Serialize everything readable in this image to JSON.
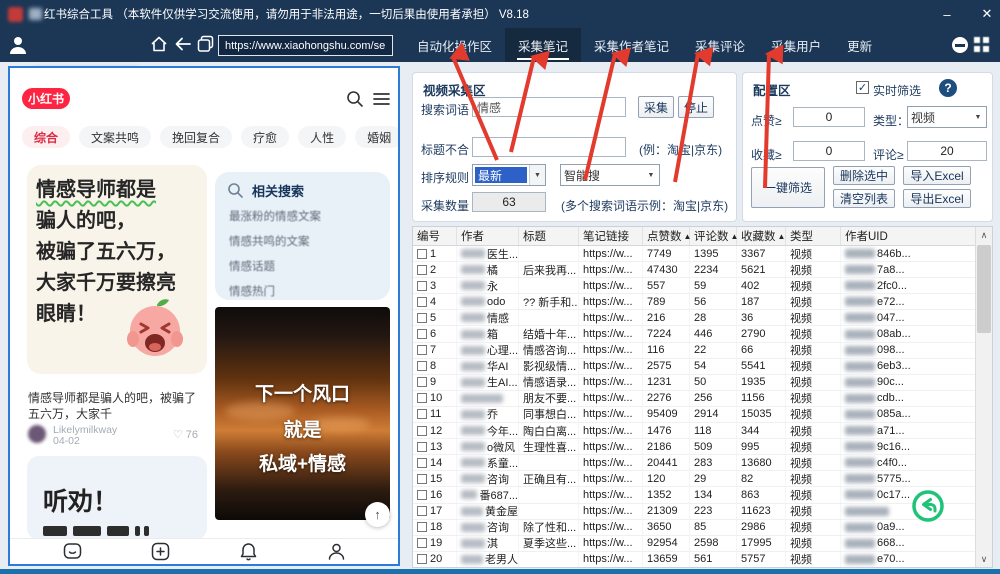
{
  "titlebar": {
    "app_title": "红书综合工具  （本软件仅供学习交流使用，请勿用于非法用途，一切后果由使用者承担）  V8.18",
    "minimize": "–",
    "close": "✕"
  },
  "navbar": {
    "url": "https://www.xiaohongshu.com/se",
    "tabs": [
      {
        "label": "自动化操作区",
        "active": false
      },
      {
        "label": "采集笔记",
        "active": true
      },
      {
        "label": "采集作者笔记",
        "active": false
      },
      {
        "label": "采集评论",
        "active": false
      },
      {
        "label": "采集用户",
        "active": false
      },
      {
        "label": "更新",
        "active": false
      }
    ]
  },
  "browser": {
    "logo": "小红书",
    "categories": [
      {
        "label": "综合",
        "active": true
      },
      {
        "label": "文案共鸣",
        "active": false
      },
      {
        "label": "挽回复合",
        "active": false
      },
      {
        "label": "疗愈",
        "active": false
      },
      {
        "label": "人性",
        "active": false
      },
      {
        "label": "婚姻",
        "active": false
      }
    ],
    "chevron": "›",
    "post1": {
      "lines": [
        "情感导师都是",
        "骗人的吧，",
        "被骗了五六万，",
        "大家千万要擦亮",
        "眼睛！"
      ],
      "caption": "情感导师都是骗人的吧，被骗了五六万，大家千",
      "author": "Likelymilkway",
      "date": "04-02",
      "likes": "76",
      "like_icon": "♡"
    },
    "related": {
      "title": "相关搜索",
      "items": [
        "最涨粉的情感文案",
        "情感共鸣的文案",
        "情感话题",
        "情感热门"
      ]
    },
    "post2": {
      "lines": [
        "下一个风口",
        "就是",
        "私域+情感"
      ]
    },
    "post3": {
      "title": "听劝！"
    },
    "totop": "↑"
  },
  "collect_panel": {
    "title": "视频采集区",
    "search_label": "搜索词语",
    "search_value": "情感",
    "collect_btn": "采集",
    "stop_btn": "停止",
    "exclude_label": "标题不合",
    "exclude_value": "",
    "exclude_hint": "(例：淘宝|京东)",
    "sort_label": "排序规则",
    "sort_value": "最新",
    "sort2_value": "智能搜",
    "count_label": "采集数量",
    "count_value": "63",
    "count_hint": "(多个搜索词语示例：淘宝|京东)"
  },
  "config_panel": {
    "title": "配置区",
    "realtime_label": "实时筛选",
    "checkbox_mark": "✓",
    "help": "?",
    "likes_label": "点赞≥",
    "likes_value": "0",
    "type_label": "类型：",
    "type_value": "视频",
    "favs_label": "收藏≥",
    "favs_value": "0",
    "comments_label": "评论≥",
    "comments_value": "20",
    "filter_btn": "一键筛选",
    "delete_btn": "删除选中",
    "clear_btn": "清空列表",
    "import_btn": "导入Excel",
    "export_btn": "导出Excel"
  },
  "table": {
    "headers": [
      {
        "label": "编号",
        "sort": ""
      },
      {
        "label": "作者",
        "sort": ""
      },
      {
        "label": "标题",
        "sort": ""
      },
      {
        "label": "笔记链接",
        "sort": ""
      },
      {
        "label": "点赞数",
        "sort": "▲"
      },
      {
        "label": "评论数",
        "sort": "▲"
      },
      {
        "label": "收藏数",
        "sort": "▲"
      },
      {
        "label": "类型",
        "sort": ""
      },
      {
        "label": "作者UID",
        "sort": ""
      }
    ],
    "rows": [
      {
        "no": "1",
        "author": "医生...",
        "title": "",
        "link": "https://w...",
        "likes": "7749",
        "comments": "1395",
        "favs": "3367",
        "type": "视频",
        "uid": "846b..."
      },
      {
        "no": "2",
        "author": "橘",
        "title": "后来我再...",
        "link": "https://w...",
        "likes": "47430",
        "comments": "2234",
        "favs": "5621",
        "type": "视频",
        "uid": "7a8..."
      },
      {
        "no": "3",
        "author": "永",
        "title": "",
        "link": "https://w...",
        "likes": "557",
        "comments": "59",
        "favs": "402",
        "type": "视频",
        "uid": "2fc0..."
      },
      {
        "no": "4",
        "author": "odo",
        "title": "?? 新手和...",
        "link": "https://w...",
        "likes": "789",
        "comments": "56",
        "favs": "187",
        "type": "视频",
        "uid": "e72..."
      },
      {
        "no": "5",
        "author": "情感",
        "title": "",
        "link": "https://w...",
        "likes": "216",
        "comments": "28",
        "favs": "36",
        "type": "视频",
        "uid": "047..."
      },
      {
        "no": "6",
        "author": "箱",
        "title": "结婚十年...",
        "link": "https://w...",
        "likes": "7224",
        "comments": "446",
        "favs": "2790",
        "type": "视频",
        "uid": "08ab..."
      },
      {
        "no": "7",
        "author": "心理...",
        "title": "情感咨询...",
        "link": "https://w...",
        "likes": "116",
        "comments": "22",
        "favs": "66",
        "type": "视频",
        "uid": "098..."
      },
      {
        "no": "8",
        "author": "华AI",
        "title": "影视级情...",
        "link": "https://w...",
        "likes": "2575",
        "comments": "54",
        "favs": "5541",
        "type": "视频",
        "uid": "6eb3..."
      },
      {
        "no": "9",
        "author": "生AI...",
        "title": "情感语录...",
        "link": "https://w...",
        "likes": "1231",
        "comments": "50",
        "favs": "1935",
        "type": "视频",
        "uid": "90c..."
      },
      {
        "no": "10",
        "author": "",
        "title": "朋友不要...",
        "link": "https://w...",
        "likes": "2276",
        "comments": "256",
        "favs": "1156",
        "type": "视频",
        "uid": "cdb..."
      },
      {
        "no": "11",
        "author": "乔",
        "title": "同事想白...",
        "link": "https://w...",
        "likes": "95409",
        "comments": "2914",
        "favs": "15035",
        "type": "视频",
        "uid": "085a..."
      },
      {
        "no": "12",
        "author": "今年...",
        "title": "陶白白离...",
        "link": "https://w...",
        "likes": "1476",
        "comments": "118",
        "favs": "344",
        "type": "视频",
        "uid": "a71..."
      },
      {
        "no": "13",
        "author": "o微风",
        "title": "生理性喜...",
        "link": "https://w...",
        "likes": "2186",
        "comments": "509",
        "favs": "995",
        "type": "视频",
        "uid": "9c16..."
      },
      {
        "no": "14",
        "author": "系童...",
        "title": "",
        "link": "https://w...",
        "likes": "20441",
        "comments": "283",
        "favs": "13680",
        "type": "视频",
        "uid": "c4f0..."
      },
      {
        "no": "15",
        "author": "咨询",
        "title": "正确且有...",
        "link": "https://w...",
        "likes": "120",
        "comments": "29",
        "favs": "82",
        "type": "视频",
        "uid": "5775..."
      },
      {
        "no": "16",
        "author": "番687...",
        "title": "",
        "link": "https://w...",
        "likes": "1352",
        "comments": "134",
        "favs": "863",
        "type": "视频",
        "uid": "0c17..."
      },
      {
        "no": "17",
        "author": "黄金屋",
        "title": "",
        "link": "https://w...",
        "likes": "21309",
        "comments": "223",
        "favs": "11623",
        "type": "视频",
        "uid": ""
      },
      {
        "no": "18",
        "author": "咨询",
        "title": "除了性和...",
        "link": "https://w...",
        "likes": "3650",
        "comments": "85",
        "favs": "2986",
        "type": "视频",
        "uid": "0a9..."
      },
      {
        "no": "19",
        "author": "淇",
        "title": "夏季这些...",
        "link": "https://w...",
        "likes": "92954",
        "comments": "2598",
        "favs": "17995",
        "type": "视频",
        "uid": "668..."
      },
      {
        "no": "20",
        "author": "老男人",
        "title": "",
        "link": "https://w...",
        "likes": "13659",
        "comments": "561",
        "favs": "5757",
        "type": "视频",
        "uid": "e70..."
      }
    ]
  }
}
